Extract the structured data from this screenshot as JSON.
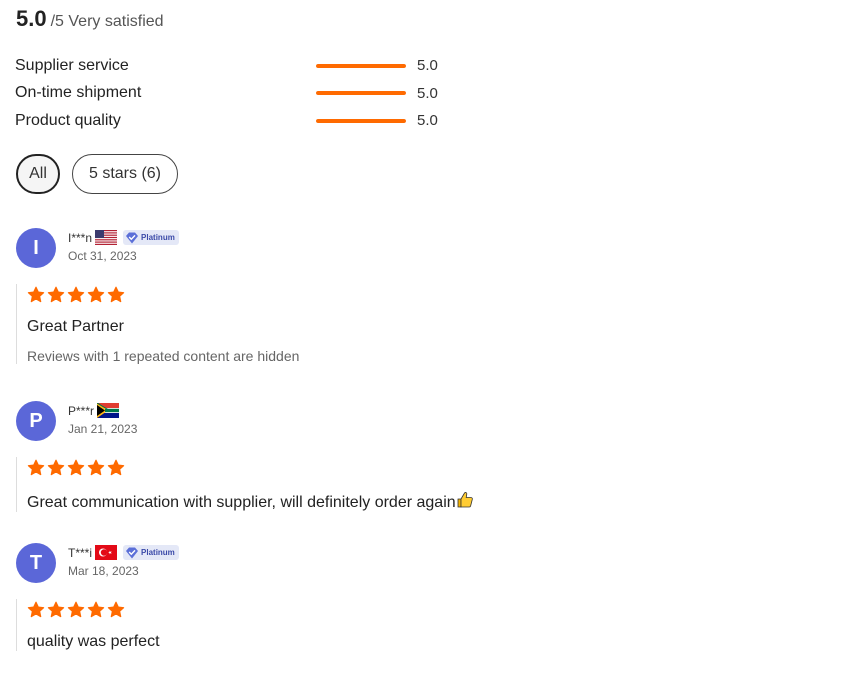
{
  "summary": {
    "score": "5.0",
    "suffix": "/5 Very satisfied"
  },
  "colors": {
    "accent": "#ff6a00",
    "avatar": "#5b67d8",
    "badge_bg": "#e4e8f7",
    "badge_text": "#3b4aa8"
  },
  "metrics": [
    {
      "label": "Supplier service",
      "value": "5.0",
      "fraction": 1.0
    },
    {
      "label": "On-time shipment",
      "value": "5.0",
      "fraction": 1.0
    },
    {
      "label": "Product quality",
      "value": "5.0",
      "fraction": 1.0
    }
  ],
  "filters": [
    {
      "label": "All",
      "active": true
    },
    {
      "label": "5 stars (6)",
      "active": false
    }
  ],
  "reviews": [
    {
      "initial": "I",
      "name": "I***n",
      "flag": "us-flag-icon",
      "badge": "Platinum",
      "date": "Oct 31, 2023",
      "rating": 5,
      "text": "Great Partner",
      "note": "Reviews with 1 repeated content are hidden"
    },
    {
      "initial": "P",
      "name": "P***r",
      "flag": "za-flag-icon",
      "badge": "",
      "date": "Jan 21, 2023",
      "rating": 5,
      "text": "Great communication with supplier, will definitely order again",
      "emoji": "thumbs-up-icon",
      "note": ""
    },
    {
      "initial": "T",
      "name": "T***i",
      "flag": "tr-flag-icon",
      "badge": "Platinum",
      "date": "Mar 18, 2023",
      "rating": 5,
      "text": "quality was perfect",
      "note": ""
    }
  ]
}
